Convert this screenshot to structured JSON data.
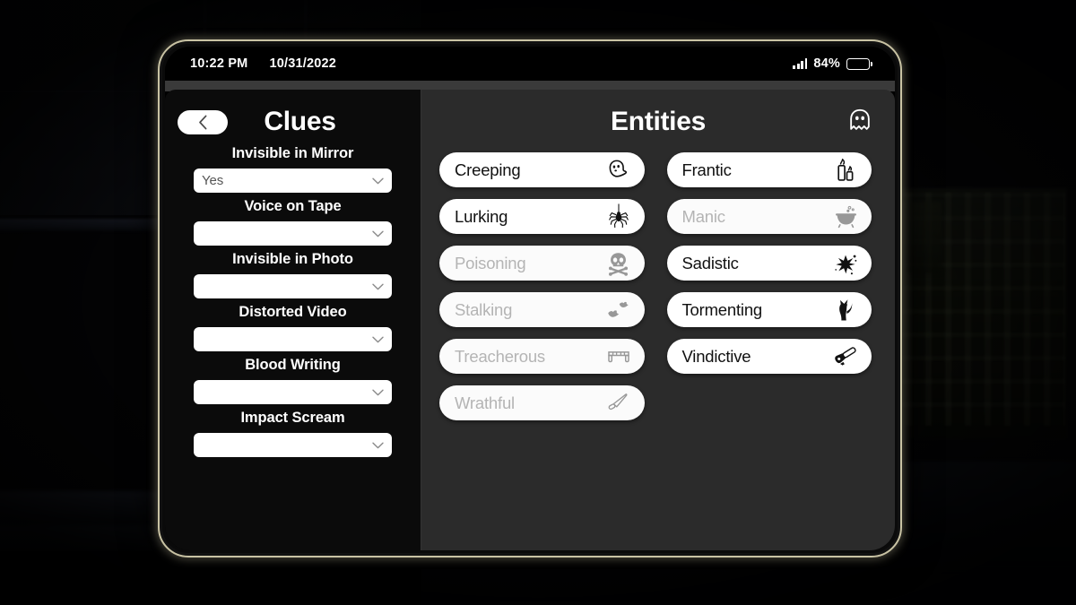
{
  "statusbar": {
    "time": "10:22 PM",
    "date": "10/31/2022",
    "battery_pct": "84%",
    "signal_icon": "signal-bars-icon",
    "battery_icon": "battery-icon"
  },
  "clues": {
    "title": "Clues",
    "back_icon": "chevron-left-icon",
    "chevron_icon": "chevron-down-icon",
    "items": [
      {
        "label": "Invisible in Mirror",
        "value": "Yes"
      },
      {
        "label": "Voice on Tape",
        "value": ""
      },
      {
        "label": "Invisible in Photo",
        "value": ""
      },
      {
        "label": "Distorted Video",
        "value": ""
      },
      {
        "label": "Blood Writing",
        "value": ""
      },
      {
        "label": "Impact Scream",
        "value": ""
      }
    ]
  },
  "entities": {
    "title": "Entities",
    "badge_icon": "ghost-icon",
    "items": [
      {
        "label": "Creeping",
        "icon": "ghost-icon",
        "active": true
      },
      {
        "label": "Frantic",
        "icon": "candles-icon",
        "active": true
      },
      {
        "label": "Lurking",
        "icon": "hanging-spider-icon",
        "active": true
      },
      {
        "label": "Manic",
        "icon": "cauldron-icon",
        "active": false
      },
      {
        "label": "Poisoning",
        "icon": "skull-crossbones-icon",
        "active": false
      },
      {
        "label": "Sadistic",
        "icon": "blood-splatter-icon",
        "active": true
      },
      {
        "label": "Stalking",
        "icon": "bats-icon",
        "active": false
      },
      {
        "label": "Tormenting",
        "icon": "black-cat-icon",
        "active": true
      },
      {
        "label": "Treacherous",
        "icon": "vampire-fangs-icon",
        "active": false
      },
      {
        "label": "Vindictive",
        "icon": "chainsaw-icon",
        "active": true
      },
      {
        "label": "Wrathful",
        "icon": "knife-icon",
        "active": false
      }
    ]
  },
  "colors": {
    "bezel": "#c9c3a4",
    "clues_panel": "#0b0b0b",
    "entities_panel": "#2b2b2b",
    "pill_active_text": "#111111",
    "pill_inactive_text": "#b4b4b4"
  }
}
